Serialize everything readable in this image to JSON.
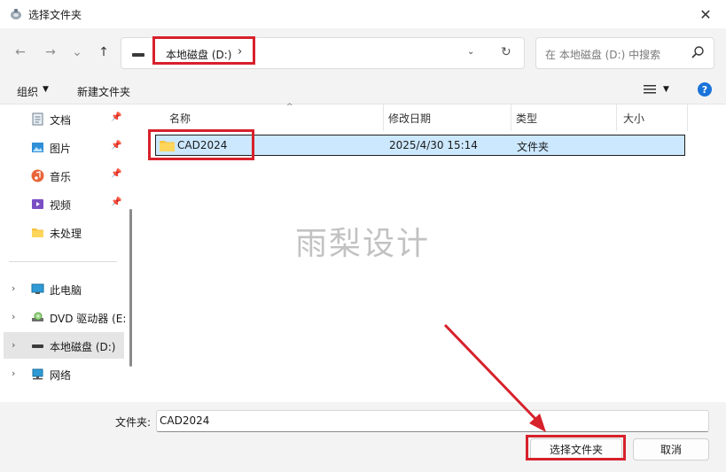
{
  "window": {
    "title": "选择文件夹",
    "close_glyph": "✕"
  },
  "nav_buttons": {
    "back": "←",
    "forward": "→",
    "recent": "⌄",
    "up": "↑"
  },
  "address": {
    "crumb": "本地磁盘 (D:)",
    "chevron": "›",
    "dropdown": "⌄",
    "refresh": "↻"
  },
  "search": {
    "placeholder": "在 本地磁盘 (D:) 中搜索"
  },
  "toolbar": {
    "organize": "组织",
    "new_folder": "新建文件夹",
    "help": "?"
  },
  "sidebar": {
    "quick_access": [
      {
        "label": "文档",
        "icon": "document-icon",
        "pinned": true
      },
      {
        "label": "图片",
        "icon": "pictures-icon",
        "pinned": true
      },
      {
        "label": "音乐",
        "icon": "music-icon",
        "pinned": true
      },
      {
        "label": "视频",
        "icon": "video-icon",
        "pinned": true
      },
      {
        "label": "未处理",
        "icon": "folder-icon",
        "pinned": false
      }
    ],
    "locations": [
      {
        "label": "此电脑",
        "icon": "computer-icon"
      },
      {
        "label": "DVD 驱动器 (E:",
        "icon": "dvd-drive-icon"
      },
      {
        "label": "本地磁盘 (D:)",
        "icon": "drive-icon",
        "selected": true
      },
      {
        "label": "网络",
        "icon": "network-icon"
      }
    ],
    "pin_glyph": "📌",
    "expand_glyph": "›"
  },
  "columns": [
    "名称",
    "修改日期",
    "类型",
    "大小"
  ],
  "files": [
    {
      "name": "CAD2024",
      "modified": "2025/4/30 15:14",
      "type": "文件夹",
      "size": ""
    }
  ],
  "watermark": "雨梨设计",
  "footer": {
    "folder_label": "文件夹:",
    "folder_value": "CAD2024",
    "select_button": "选择文件夹",
    "cancel_button": "取消"
  },
  "colors": {
    "selection": "#cce8ff",
    "highlight": "#d7212b",
    "accent": "#1a73d9"
  }
}
